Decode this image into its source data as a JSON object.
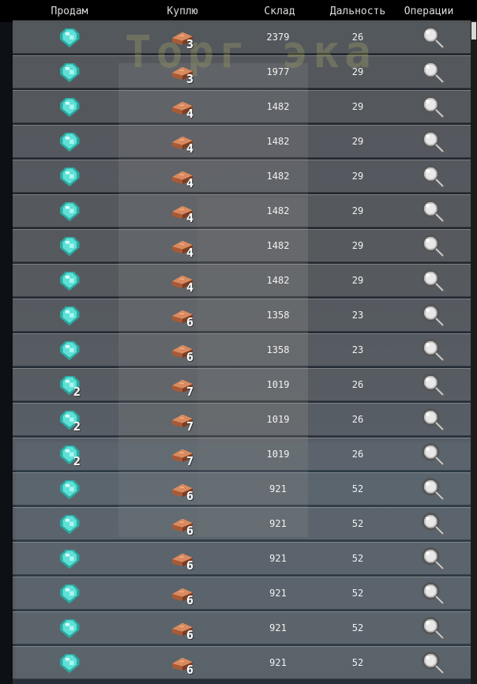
{
  "columns": {
    "sell": "Продам",
    "buy": "Куплю",
    "stock": "Склад",
    "distance": "Дальность",
    "operations": "Операции"
  },
  "background_title": "Торг  эка",
  "rows": [
    {
      "sell_icon": "diamond-icon",
      "sell_count": "",
      "buy_icon": "brick-icon",
      "buy_count": "3",
      "stock": "2379",
      "distance": "26",
      "action_icon": "magnifier-icon"
    },
    {
      "sell_icon": "diamond-icon",
      "sell_count": "",
      "buy_icon": "brick-icon",
      "buy_count": "3",
      "stock": "1977",
      "distance": "29",
      "action_icon": "magnifier-icon"
    },
    {
      "sell_icon": "diamond-icon",
      "sell_count": "",
      "buy_icon": "brick-icon",
      "buy_count": "4",
      "stock": "1482",
      "distance": "29",
      "action_icon": "magnifier-icon"
    },
    {
      "sell_icon": "diamond-icon",
      "sell_count": "",
      "buy_icon": "brick-icon",
      "buy_count": "4",
      "stock": "1482",
      "distance": "29",
      "action_icon": "magnifier-icon"
    },
    {
      "sell_icon": "diamond-icon",
      "sell_count": "",
      "buy_icon": "brick-icon",
      "buy_count": "4",
      "stock": "1482",
      "distance": "29",
      "action_icon": "magnifier-icon"
    },
    {
      "sell_icon": "diamond-icon",
      "sell_count": "",
      "buy_icon": "brick-icon",
      "buy_count": "4",
      "stock": "1482",
      "distance": "29",
      "action_icon": "magnifier-icon"
    },
    {
      "sell_icon": "diamond-icon",
      "sell_count": "",
      "buy_icon": "brick-icon",
      "buy_count": "4",
      "stock": "1482",
      "distance": "29",
      "action_icon": "magnifier-icon"
    },
    {
      "sell_icon": "diamond-icon",
      "sell_count": "",
      "buy_icon": "brick-icon",
      "buy_count": "4",
      "stock": "1482",
      "distance": "29",
      "action_icon": "magnifier-icon"
    },
    {
      "sell_icon": "diamond-icon",
      "sell_count": "",
      "buy_icon": "brick-icon",
      "buy_count": "6",
      "stock": "1358",
      "distance": "23",
      "action_icon": "magnifier-icon"
    },
    {
      "sell_icon": "diamond-icon",
      "sell_count": "",
      "buy_icon": "brick-icon",
      "buy_count": "6",
      "stock": "1358",
      "distance": "23",
      "action_icon": "magnifier-icon"
    },
    {
      "sell_icon": "diamond-icon",
      "sell_count": "2",
      "buy_icon": "brick-icon",
      "buy_count": "7",
      "stock": "1019",
      "distance": "26",
      "action_icon": "magnifier-icon"
    },
    {
      "sell_icon": "diamond-icon",
      "sell_count": "2",
      "buy_icon": "brick-icon",
      "buy_count": "7",
      "stock": "1019",
      "distance": "26",
      "action_icon": "magnifier-icon"
    },
    {
      "sell_icon": "diamond-icon",
      "sell_count": "2",
      "buy_icon": "brick-icon",
      "buy_count": "7",
      "stock": "1019",
      "distance": "26",
      "action_icon": "magnifier-icon"
    },
    {
      "sell_icon": "diamond-icon",
      "sell_count": "",
      "buy_icon": "brick-icon",
      "buy_count": "6",
      "stock": "921",
      "distance": "52",
      "action_icon": "magnifier-icon"
    },
    {
      "sell_icon": "diamond-icon",
      "sell_count": "",
      "buy_icon": "brick-icon",
      "buy_count": "6",
      "stock": "921",
      "distance": "52",
      "action_icon": "magnifier-icon"
    },
    {
      "sell_icon": "diamond-icon",
      "sell_count": "",
      "buy_icon": "brick-icon",
      "buy_count": "6",
      "stock": "921",
      "distance": "52",
      "action_icon": "magnifier-icon"
    },
    {
      "sell_icon": "diamond-icon",
      "sell_count": "",
      "buy_icon": "brick-icon",
      "buy_count": "6",
      "stock": "921",
      "distance": "52",
      "action_icon": "magnifier-icon"
    },
    {
      "sell_icon": "diamond-icon",
      "sell_count": "",
      "buy_icon": "brick-icon",
      "buy_count": "6",
      "stock": "921",
      "distance": "52",
      "action_icon": "magnifier-icon"
    },
    {
      "sell_icon": "diamond-icon",
      "sell_count": "",
      "buy_icon": "brick-icon",
      "buy_count": "6",
      "stock": "921",
      "distance": "52",
      "action_icon": "magnifier-icon"
    }
  ],
  "colors": {
    "row_bg": "#8c8c8c",
    "header_bg": "#000000",
    "diamond": "#5fe0d6",
    "brick": "#c8724a"
  }
}
